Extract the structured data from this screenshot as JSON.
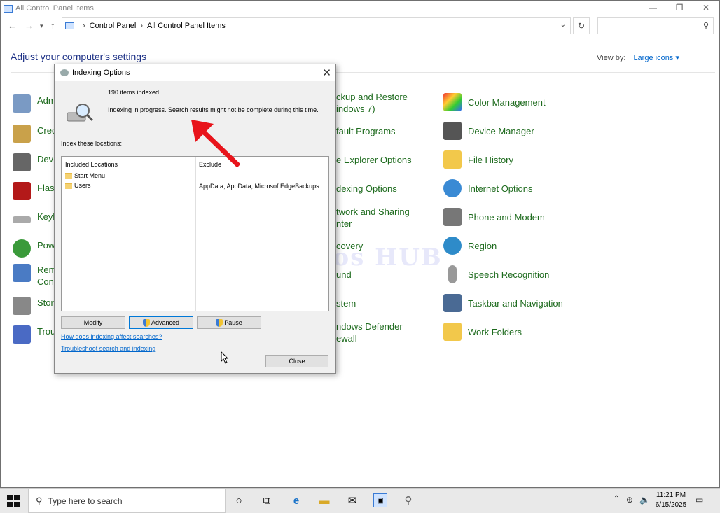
{
  "window": {
    "title": "All Control Panel Items",
    "controls": [
      "—",
      "❐",
      "✕"
    ]
  },
  "address": {
    "crumbs": [
      "Control Panel",
      "All Control Panel Items"
    ],
    "search_placeholder": ""
  },
  "content": {
    "heading": "Adjust your computer's settings",
    "view_by_label": "View by:",
    "view_by_value": "Large icons ▾"
  },
  "items": {
    "col1": [
      "Adm",
      "Cred",
      "Devi",
      "Flash",
      "Keyb",
      "Pow",
      "Rem\nConn",
      "Stora",
      "Trou"
    ],
    "col2": [
      "ckup and Restore\nindows 7)",
      "fault Programs",
      "e Explorer Options",
      "dexing Options",
      "twork and Sharing\nnter",
      "covery",
      "und",
      "stem",
      "ndows Defender\newall"
    ],
    "col3": [
      "Color Management",
      "Device Manager",
      "File History",
      "Internet Options",
      "Phone and Modem",
      "Region",
      "Speech Recognition",
      "Taskbar and Navigation",
      "Work Folders"
    ]
  },
  "dialog": {
    "title": "Indexing Options",
    "items_indexed": "190 items indexed",
    "status": "Indexing in progress. Search results might not be complete during this time.",
    "index_label": "Index these locations:",
    "col_included": "Included Locations",
    "col_exclude": "Exclude",
    "rows": [
      {
        "location": "Start Menu",
        "exclude": ""
      },
      {
        "location": "Users",
        "exclude": "AppData; AppData; MicrosoftEdgeBackups"
      }
    ],
    "btn_modify": "Modify",
    "btn_advanced": "Advanced",
    "btn_pause": "Pause",
    "link1": "How does indexing affect searches?",
    "link2": "Troubleshoot search and indexing",
    "btn_close": "Close"
  },
  "watermark": "IT Pros HUB",
  "taskbar": {
    "search_placeholder": "Type here to search",
    "time": "11:21 PM",
    "date": "6/15/2025"
  },
  "colors": {
    "link_green": "#1e6b1e",
    "heading_blue": "#1e3287",
    "arrow_red": "#e8141b"
  }
}
